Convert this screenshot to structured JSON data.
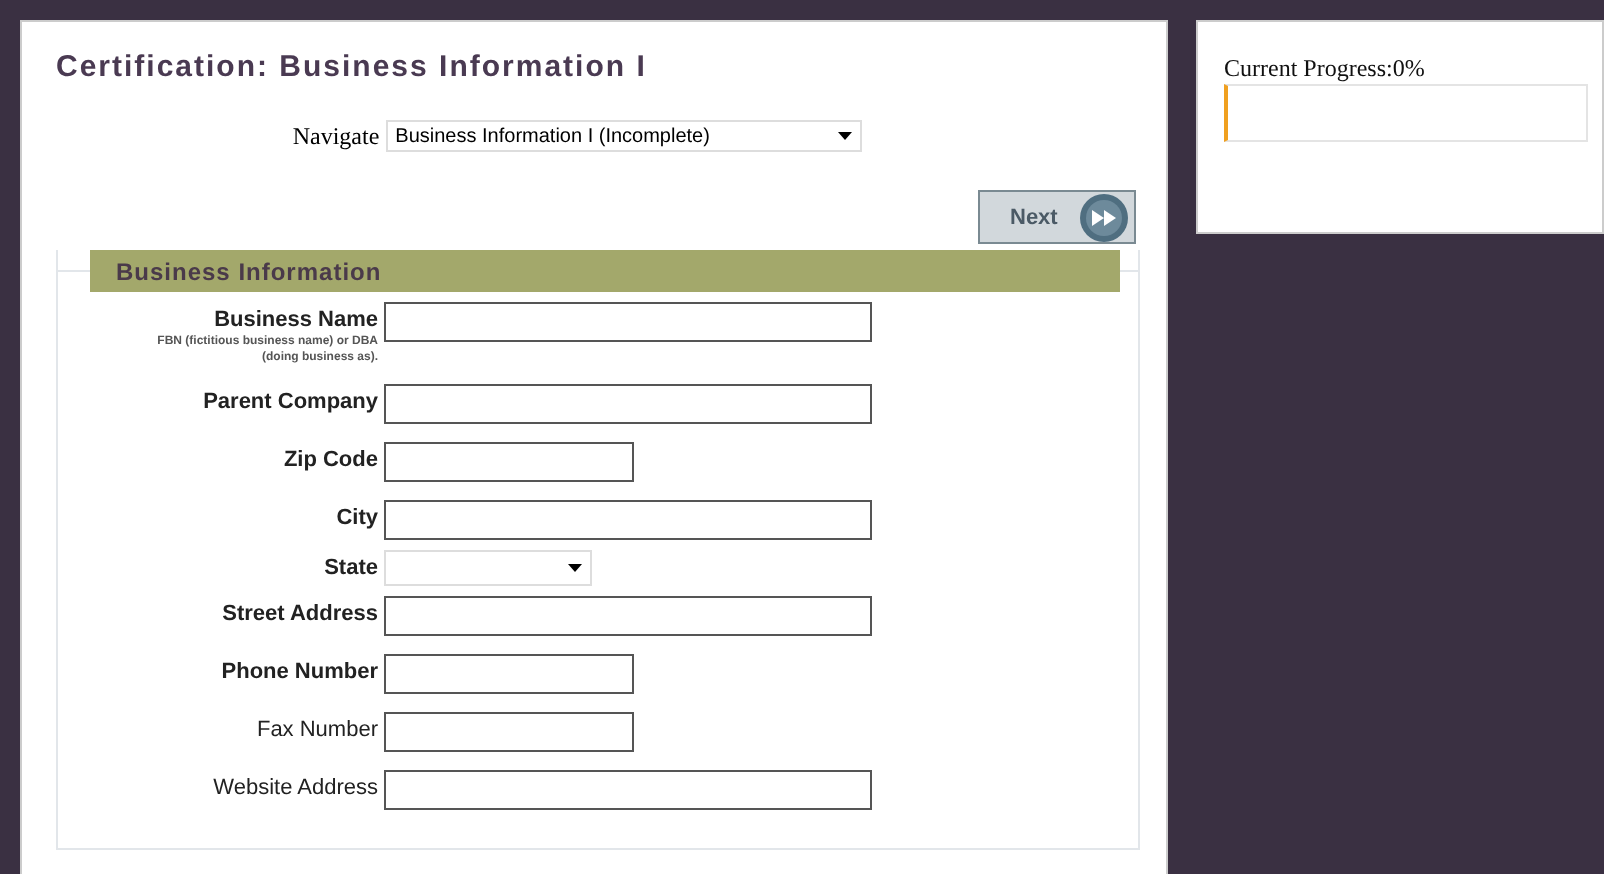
{
  "page_title": "Certification: Business Information I",
  "navigate": {
    "label": "Navigate",
    "value": "Business Information I (Incomplete)"
  },
  "next_button": {
    "label": "Next"
  },
  "section": {
    "title": "Business Information",
    "fields": [
      {
        "label": "Business Name",
        "hint": "FBN (fictitious business name) or DBA (doing business as).",
        "kind": "wide",
        "required": true
      },
      {
        "label": "Parent Company",
        "kind": "wide",
        "required": true
      },
      {
        "label": "Zip Code",
        "kind": "narrow",
        "required": true
      },
      {
        "label": "City",
        "kind": "wide",
        "required": true
      },
      {
        "label": "State",
        "kind": "select",
        "required": true
      },
      {
        "label": "Street Address",
        "kind": "wide",
        "required": true
      },
      {
        "label": "Phone Number",
        "kind": "narrow",
        "required": true
      },
      {
        "label": "Fax Number",
        "kind": "narrow",
        "required": false
      },
      {
        "label": "Website Address",
        "kind": "wide",
        "required": false
      }
    ]
  },
  "progress": {
    "label": "Current Progress:0%",
    "level": 0
  }
}
